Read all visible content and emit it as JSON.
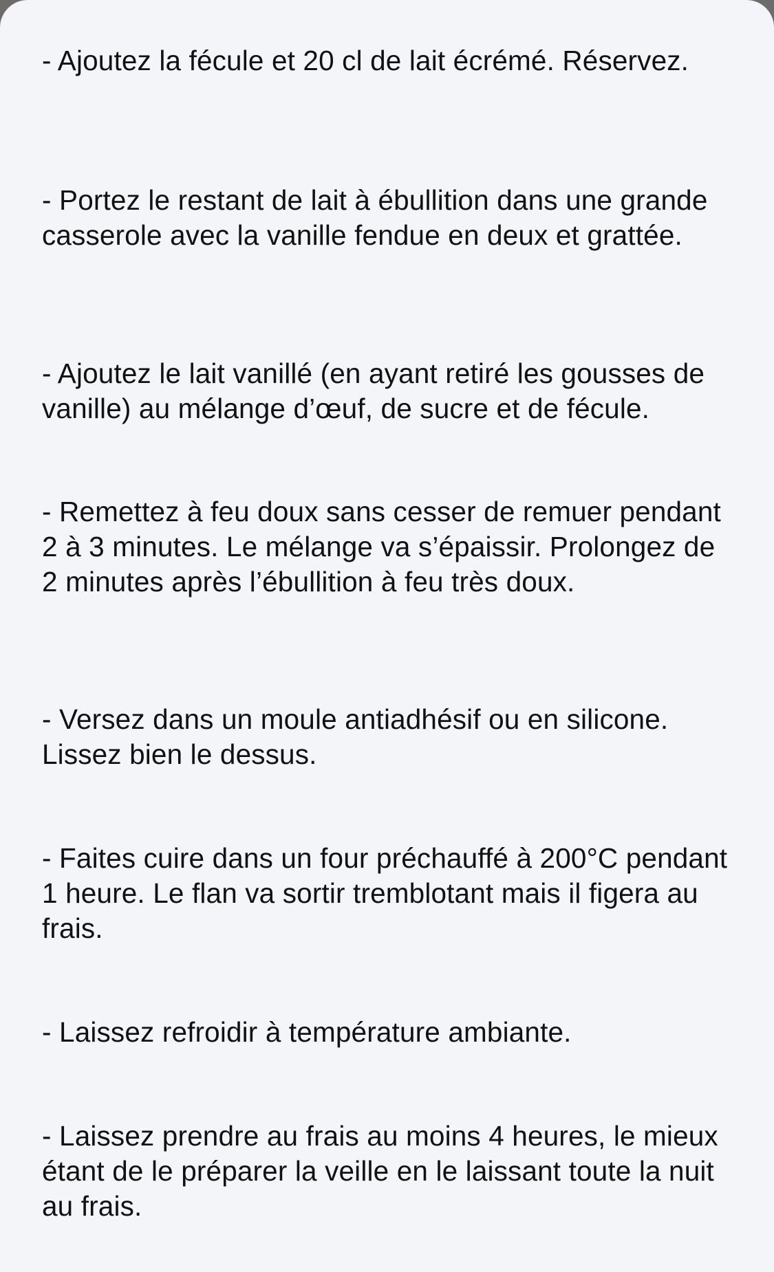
{
  "recipe": {
    "steps": [
      "- Ajoutez la fécule et 20 cl de lait écrémé. Réservez.",
      "- Portez le restant de lait à ébullition dans une grande casserole avec la vanille fendue en deux et grattée.",
      "- Ajoutez le lait vanillé (en ayant retiré les gousses de vanille) au mélange d’œuf, de sucre et de fécule.",
      "- Remettez à feu doux sans cesser de remuer pendant 2 à 3 minutes. Le mélange va s’épaissir. Prolongez de 2 minutes après l’ébullition à feu très doux.",
      "- Versez dans un moule antiadhésif ou en silicone. Lissez bien le dessus.",
      "- Faites cuire dans un four préchauffé à 200°C pendant 1 heure. Le flan va sortir tremblotant mais il figera au frais.",
      "- Laissez refroidir à température ambiante.",
      "- Laissez prendre au frais au moins 4 heures, le mieux étant de le préparer la veille en le laissant toute la nuit au frais."
    ]
  }
}
